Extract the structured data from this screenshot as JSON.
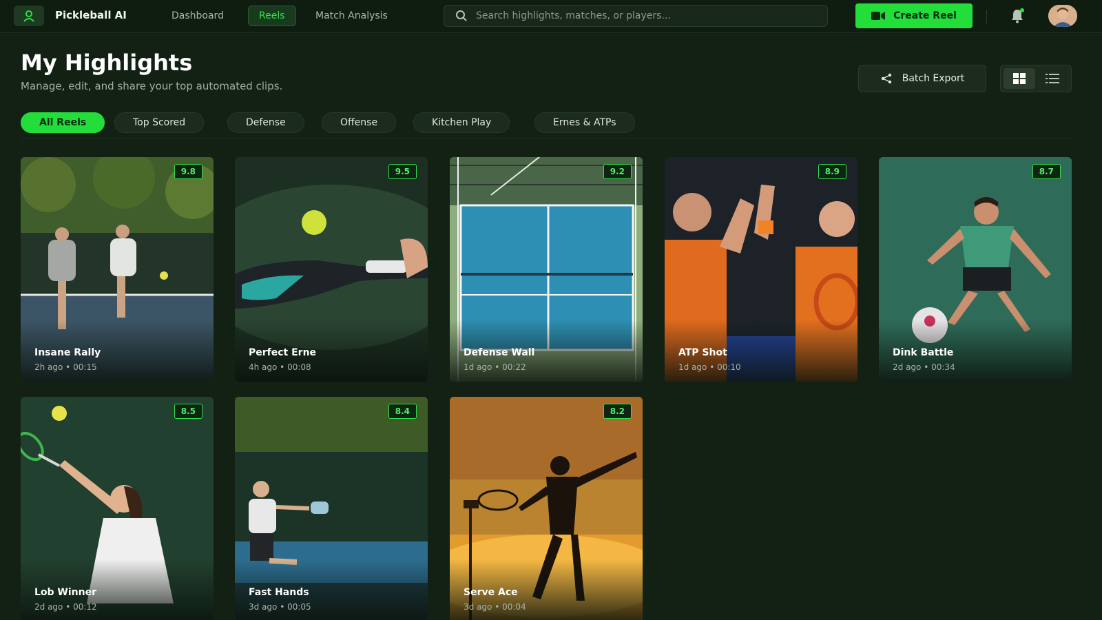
{
  "app": {
    "name": "Pickleball AI"
  },
  "nav": [
    {
      "label": "Dashboard",
      "active": false
    },
    {
      "label": "Reels",
      "active": true
    },
    {
      "label": "Match Analysis",
      "active": false
    }
  ],
  "search": {
    "placeholder": "Search highlights, matches, or players..."
  },
  "actions": {
    "create_label": "Create Reel"
  },
  "header": {
    "title": "My Highlights",
    "subtitle": "Manage, edit, and share your top automated clips.",
    "batch_export_label": "Batch Export",
    "view_mode": "grid"
  },
  "filters": [
    {
      "label": "All Reels",
      "active": true
    },
    {
      "label": "Top Scored",
      "active": false
    },
    {
      "label": "Defense",
      "active": false
    },
    {
      "label": "Offense",
      "active": false
    },
    {
      "label": "Kitchen Play",
      "active": false
    },
    {
      "label": "Ernes & ATPs",
      "active": false
    }
  ],
  "reels": [
    {
      "title": "Insane Rally",
      "meta": "2h ago • 00:15",
      "score": "9.8"
    },
    {
      "title": "Perfect Erne",
      "meta": "4h ago • 00:08",
      "score": "9.5"
    },
    {
      "title": "Defense Wall",
      "meta": "1d ago • 00:22",
      "score": "9.2"
    },
    {
      "title": "ATP Shot",
      "meta": "1d ago • 00:10",
      "score": "8.9"
    },
    {
      "title": "Dink Battle",
      "meta": "2d ago • 00:34",
      "score": "8.7"
    },
    {
      "title": "Lob Winner",
      "meta": "2d ago • 00:12",
      "score": "8.5"
    },
    {
      "title": "Fast Hands",
      "meta": "3d ago • 00:05",
      "score": "8.4"
    },
    {
      "title": "Serve Ace",
      "meta": "3d ago • 00:04",
      "score": "8.2"
    }
  ],
  "colors": {
    "accent": "#22dd3a",
    "background": "#122114",
    "card": "#1a2a1c"
  },
  "icons": [
    "logo-icon",
    "search-icon",
    "video-camera-icon",
    "bell-icon",
    "share-icon",
    "grid-view-icon",
    "list-view-icon"
  ]
}
